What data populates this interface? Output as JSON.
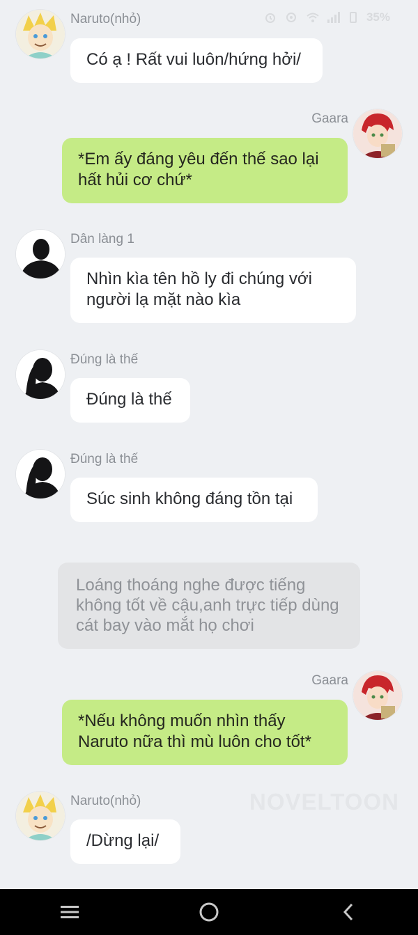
{
  "status_bar": {
    "battery": "35%"
  },
  "watermark": "NOVELTOON",
  "messages": [
    {
      "sender": "Naruto(nhỏ)",
      "text": "Có ạ ! Rất vui luôn/hứng hởi/"
    },
    {
      "sender": "Gaara",
      "text": "*Em ấy đáng yêu đến thế sao lại hất hủi cơ chứ*"
    },
    {
      "sender": "Dân làng 1",
      "text": "Nhìn kìa tên hồ ly đi chúng với người lạ mặt nào kìa"
    },
    {
      "sender": "Đúng là thế",
      "text": "Đúng là thế"
    },
    {
      "sender": "Đúng là thế",
      "text": "Súc sinh không đáng tồn tại"
    },
    {
      "sender": "",
      "text": "Loáng thoáng nghe được tiếng không tốt về cậu,anh trực tiếp dùng cát bay vào mắt họ chơi"
    },
    {
      "sender": "Gaara",
      "text": "*Nếu không muốn nhìn thấy Naruto nữa thì mù luôn cho tốt*"
    },
    {
      "sender": "Naruto(nhỏ)",
      "text": "/Dừng lại/"
    }
  ]
}
